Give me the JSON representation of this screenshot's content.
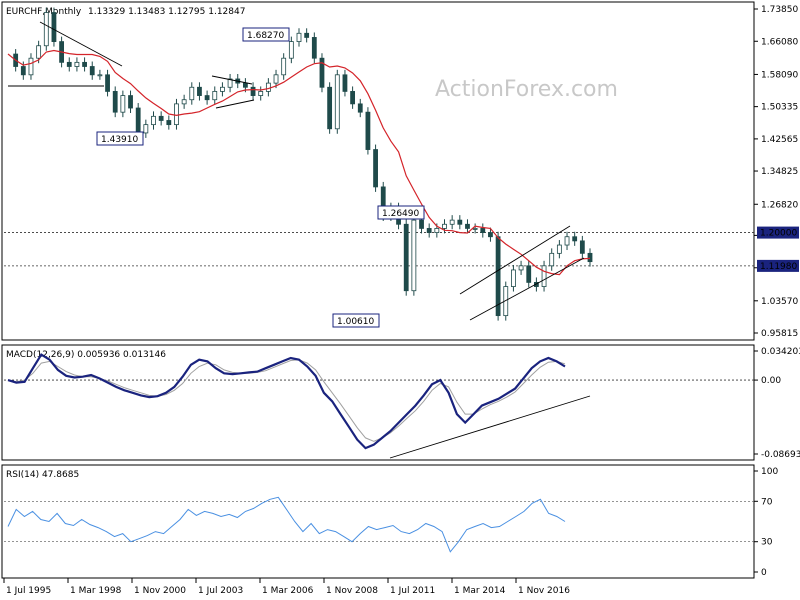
{
  "chart_data": [
    {
      "type": "candlestick",
      "header": {
        "symbol_label": "EURCHF,Monthly",
        "ohlc_text": "1.13329 1.13483 1.12795 1.12847"
      },
      "watermark": "ActionForex.com",
      "yaxis": {
        "ticks": [
          {
            "label": "1.73850",
            "value": 1.7385
          },
          {
            "label": "1.66080",
            "value": 1.6608
          },
          {
            "label": "1.58090",
            "value": 1.5809
          },
          {
            "label": "1.50335",
            "value": 1.50335
          },
          {
            "label": "1.42565",
            "value": 1.42565
          },
          {
            "label": "1.34825",
            "value": 1.34825
          },
          {
            "label": "1.26820",
            "value": 1.2682
          },
          {
            "label": "1.19325",
            "value": 1.19325
          },
          {
            "label": "1.11525",
            "value": 1.11525
          },
          {
            "label": "1.03570",
            "value": 1.0357
          },
          {
            "label": "0.95815",
            "value": 0.95815
          }
        ],
        "ylim": [
          0.95815,
          1.7385
        ]
      },
      "levels": [
        {
          "label": "1.20000",
          "value": 1.2
        },
        {
          "label": "1.11980",
          "value": 1.1198
        }
      ],
      "annotations": [
        {
          "label": "1.68270",
          "value": 1.6827
        },
        {
          "label": "1.43910",
          "value": 1.4391
        },
        {
          "label": "1.26490",
          "value": 1.2649
        },
        {
          "label": "1.00610",
          "value": 1.0061
        }
      ],
      "moving_average": "red line",
      "price_path": [
        1.63,
        1.6,
        1.58,
        1.62,
        1.65,
        1.73,
        1.66,
        1.61,
        1.6,
        1.61,
        1.6,
        1.58,
        1.58,
        1.54,
        1.49,
        1.53,
        1.5,
        1.44,
        1.46,
        1.48,
        1.47,
        1.46,
        1.51,
        1.52,
        1.55,
        1.53,
        1.52,
        1.54,
        1.55,
        1.57,
        1.56,
        1.55,
        1.53,
        1.54,
        1.56,
        1.58,
        1.62,
        1.66,
        1.68,
        1.67,
        1.62,
        1.55,
        1.45,
        1.58,
        1.54,
        1.51,
        1.49,
        1.4,
        1.31,
        1.24,
        1.26,
        1.22,
        1.06,
        1.23,
        1.21,
        1.2,
        1.21,
        1.22,
        1.23,
        1.22,
        1.21,
        1.21,
        1.2,
        1.19,
        1.0,
        1.07,
        1.11,
        1.12,
        1.08,
        1.07,
        1.12,
        1.15,
        1.17,
        1.19,
        1.18,
        1.15,
        1.13
      ]
    },
    {
      "type": "line",
      "title": "MACD(12,26,9) 0.005936 0.013146",
      "yaxis": {
        "ticks": [
          {
            "label": "0.034203",
            "value": 0.034203
          },
          {
            "label": "0.00",
            "value": 0.0
          },
          {
            "label": "-0.086933",
            "value": -0.086933
          }
        ],
        "ylim": [
          -0.086933,
          0.034203
        ]
      },
      "series": [
        {
          "values": [
            0.0,
            -0.003,
            -0.002,
            0.014,
            0.03,
            0.024,
            0.012,
            0.005,
            0.003,
            0.004,
            0.006,
            0.002,
            -0.003,
            -0.008,
            -0.012,
            -0.015,
            -0.018,
            -0.02,
            -0.019,
            -0.015,
            -0.008,
            0.004,
            0.018,
            0.024,
            0.022,
            0.014,
            0.008,
            0.007,
            0.008,
            0.009,
            0.01,
            0.014,
            0.018,
            0.022,
            0.026,
            0.024,
            0.016,
            0.005,
            -0.015,
            -0.025,
            -0.04,
            -0.055,
            -0.07,
            -0.08,
            -0.076,
            -0.068,
            -0.06,
            -0.05,
            -0.04,
            -0.03,
            -0.018,
            -0.005,
            0.0,
            -0.015,
            -0.04,
            -0.05,
            -0.04,
            -0.03,
            -0.026,
            -0.022,
            -0.016,
            -0.01,
            0.002,
            0.014,
            0.022,
            0.026,
            0.022,
            0.016
          ]
        },
        {
          "values": [
            0.0,
            -0.002,
            0.0,
            0.008,
            0.02,
            0.022,
            0.016,
            0.01,
            0.006,
            0.004,
            0.004,
            0.002,
            -0.001,
            -0.005,
            -0.009,
            -0.012,
            -0.015,
            -0.018,
            -0.019,
            -0.017,
            -0.012,
            -0.004,
            0.008,
            0.016,
            0.02,
            0.018,
            0.012,
            0.009,
            0.008,
            0.008,
            0.009,
            0.011,
            0.015,
            0.019,
            0.023,
            0.024,
            0.02,
            0.012,
            -0.002,
            -0.015,
            -0.028,
            -0.042,
            -0.056,
            -0.068,
            -0.072,
            -0.068,
            -0.062,
            -0.054,
            -0.045,
            -0.036,
            -0.025,
            -0.012,
            -0.004,
            -0.008,
            -0.026,
            -0.04,
            -0.04,
            -0.034,
            -0.029,
            -0.025,
            -0.02,
            -0.014,
            -0.004,
            0.006,
            0.015,
            0.021,
            0.022,
            0.019
          ]
        }
      ]
    },
    {
      "type": "line",
      "title": "RSI(14) 47.8685",
      "yaxis": {
        "ticks": [
          {
            "label": "100",
            "value": 100
          },
          {
            "label": "70",
            "value": 70
          },
          {
            "label": "30",
            "value": 30
          },
          {
            "label": "0",
            "value": 0
          }
        ],
        "ylim": [
          0,
          100
        ]
      },
      "series": [
        {
          "values": [
            45,
            62,
            55,
            60,
            52,
            50,
            58,
            48,
            46,
            52,
            47,
            44,
            40,
            35,
            38,
            30,
            33,
            36,
            40,
            38,
            45,
            52,
            62,
            56,
            60,
            58,
            55,
            57,
            54,
            60,
            63,
            68,
            72,
            74,
            62,
            50,
            40,
            48,
            38,
            42,
            40,
            35,
            30,
            38,
            45,
            42,
            44,
            46,
            40,
            38,
            42,
            48,
            45,
            40,
            20,
            30,
            42,
            45,
            48,
            44,
            45,
            50,
            55,
            60,
            68,
            72,
            58,
            55,
            50
          ]
        }
      ]
    }
  ],
  "xaxis": {
    "ticks": [
      "1 Jul 1995",
      "1 Mar 1998",
      "1 Nov 2000",
      "1 Jul 2003",
      "1 Mar 2006",
      "1 Nov 2008",
      "1 Jul 2011",
      "1 Mar 2014",
      "1 Nov 2016"
    ]
  },
  "colors": {
    "candle": "#1f4a4a",
    "moving_average": "#d4242a",
    "macd_main": "#1a237e",
    "macd_signal": "#a0a0a0",
    "rsi": "#4a90e2",
    "label_box_bg": "#ffffff",
    "label_box_border": "#1a237e",
    "level_box_bg": "#1a237e",
    "level_box_text": "#ffffff",
    "trend_line": "#000000"
  }
}
